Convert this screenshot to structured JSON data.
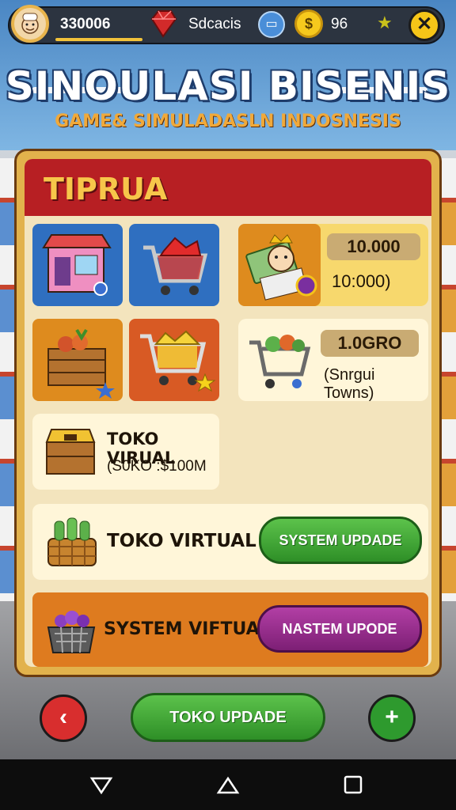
{
  "topbar": {
    "coins": "330006",
    "status": "Sdcacis",
    "count": "96",
    "icons": {
      "avatar": "chef-avatar-icon",
      "gem": "red-gem-icon",
      "chip": "chip-icon",
      "coin": "gold-coin-icon",
      "star": "star-icon",
      "close": "close-icon"
    }
  },
  "title": "SINOULASI BISENIS",
  "subtitle": "GAME& SIMULADASLN INDOSNESIS",
  "panel": {
    "title": "TIPRUA",
    "card_money": {
      "value": "10.000",
      "sub": "10:000)"
    },
    "card_cart": {
      "value": "1.0GRO",
      "sub": "(Snrgui Towns)"
    },
    "card_toko": {
      "title": "TOKO VIRUAL",
      "sub": "(S0KO :$100M"
    },
    "row_green": {
      "label": "TOKO VIRTUAL",
      "button": "SYSTEM UPDADE"
    },
    "row_orange": {
      "label": "SYSTEM VIFTUAH",
      "button": "NASTEM UPODE"
    }
  },
  "bottom": {
    "main_button": "TOKO UPDADE",
    "back": "‹",
    "plus": "+"
  },
  "colors": {
    "accent_red": "#b71f23",
    "green": "#2e8f27",
    "purple": "#7d1f75",
    "gold": "#e2b24c"
  }
}
